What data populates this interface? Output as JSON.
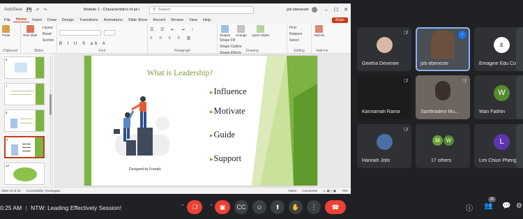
{
  "ppt": {
    "quick_access": [
      "AutoSave",
      "💾",
      "↶",
      "↷"
    ],
    "doc_title": "Module 1 - Characteristics of an Effective Leader(1) - PowerP...",
    "search_placeholder": "Search",
    "user_name": "job ebenezer",
    "menu": [
      "File",
      "Home",
      "Insert",
      "Draw",
      "Design",
      "Transitions",
      "Animations",
      "Slide Show",
      "Record",
      "Review",
      "View",
      "Help"
    ],
    "share_label": "Share",
    "ribbon": {
      "clipboard": {
        "paste": "Paste",
        "label": "Clipboard"
      },
      "slides": {
        "new_slide": "New Slide",
        "layout": "Layout",
        "reset": "Reset",
        "section": "Section",
        "label": "Slides"
      },
      "font": {
        "label": "Font"
      },
      "paragraph": {
        "label": "Paragraph"
      },
      "drawing": {
        "shapes": "Shapes",
        "arrange": "Arrange",
        "quick_styles": "Quick Styles",
        "shape_fill": "Shape Fill",
        "shape_outline": "Shape Outline",
        "shape_effects": "Shape Effects",
        "label": "Drawing"
      },
      "editing": {
        "find": "Find",
        "replace": "Replace",
        "select": "Select",
        "label": "Editing"
      },
      "addins": {
        "button": "Add-ins",
        "label": "Add-ins"
      }
    },
    "thumbnails": [
      {
        "num": "6"
      },
      {
        "num": "7"
      },
      {
        "num": "8"
      },
      {
        "num": "9"
      },
      {
        "num": "10"
      },
      {
        "num": "11"
      }
    ],
    "slide": {
      "title": "What is Leadership?",
      "bullets": [
        "Influence",
        "Motivate",
        "Guide",
        "Support"
      ],
      "credit": "Designed by Freepik"
    },
    "status": {
      "slide_count": "Slide 10 of 20",
      "accessibility": "Accessibility: Investigate",
      "notes": "Notes",
      "comments": "Comments",
      "zoom": "70%"
    },
    "colors": {
      "accent": "#c43e1c",
      "slide_green": "#7cb342"
    }
  },
  "meet": {
    "participants": [
      {
        "name": "Geetha Devenee",
        "muted": true
      },
      {
        "name": "job ebenezer",
        "speaking": true
      },
      {
        "name": "Emagine Edu Co...",
        "muted": true
      },
      {
        "name": "Kannamah Rama",
        "muted": true
      },
      {
        "name": "Santhradevi Mu...",
        "muted": true
      },
      {
        "name": "Wan Fatihin",
        "muted": true,
        "initial": "W"
      },
      {
        "name": "Hannah Jolis",
        "muted": true
      },
      {
        "name": "17 others",
        "initial_m": "M",
        "initial_w": "W"
      },
      {
        "name": "Lim Chiun Pheng",
        "muted": true,
        "initial": "L"
      }
    ],
    "bottom": {
      "time": "0:25 AM",
      "separator": "|",
      "meeting_title": "NTW: Leading Effectively Session!",
      "people_count": "26"
    }
  }
}
